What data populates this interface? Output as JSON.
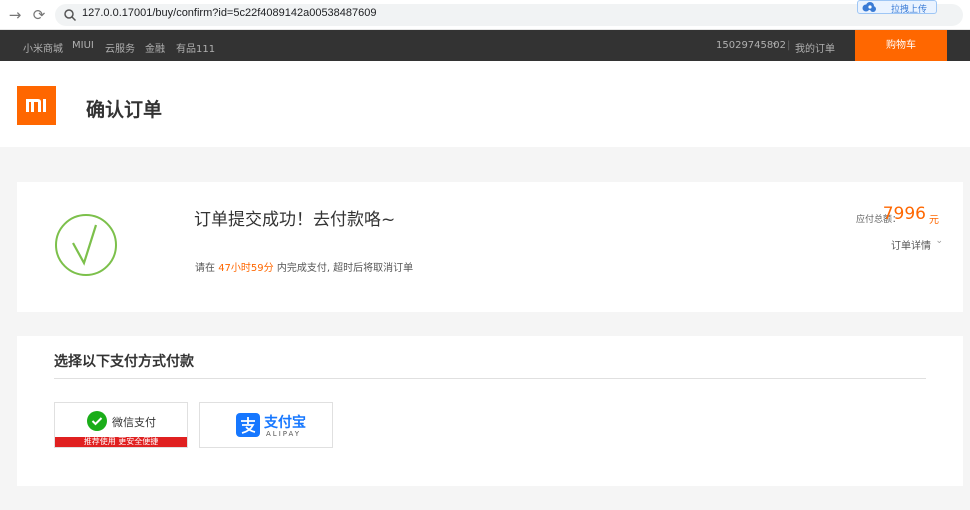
{
  "browser": {
    "url": "127.0.0.17001/buy/confirm?id=5c22f4089142a00538487609",
    "upload_label": "拉拽上传"
  },
  "topnav": {
    "links": [
      "小米商城",
      "MIUI",
      "云服务",
      "金融",
      "有品111"
    ],
    "user": "15029745802",
    "separator": "|",
    "my_orders": "我的订单",
    "cart": "购物车"
  },
  "header": {
    "title": "确认订单"
  },
  "order": {
    "success_title": "订单提交成功！去付款咯~",
    "deadline_prefix": "请在",
    "deadline_time": "47小时59分",
    "deadline_suffix": "内完成支付, 超时后将取消订单",
    "amount_label": "应付总额：",
    "amount_value": "7996",
    "amount_unit": "元",
    "detail_label": "订单详情"
  },
  "payment": {
    "title": "选择以下支付方式付款",
    "wechat_label": "微信支付",
    "wechat_note": "推荐使用 更安全便捷",
    "alipay_cn": "支付宝",
    "alipay_en": "ALIPAY"
  },
  "colors": {
    "accent": "#ff6700",
    "success_green": "#7cc04b",
    "wechat_green": "#1aad19",
    "alipay_blue": "#1677ff"
  }
}
